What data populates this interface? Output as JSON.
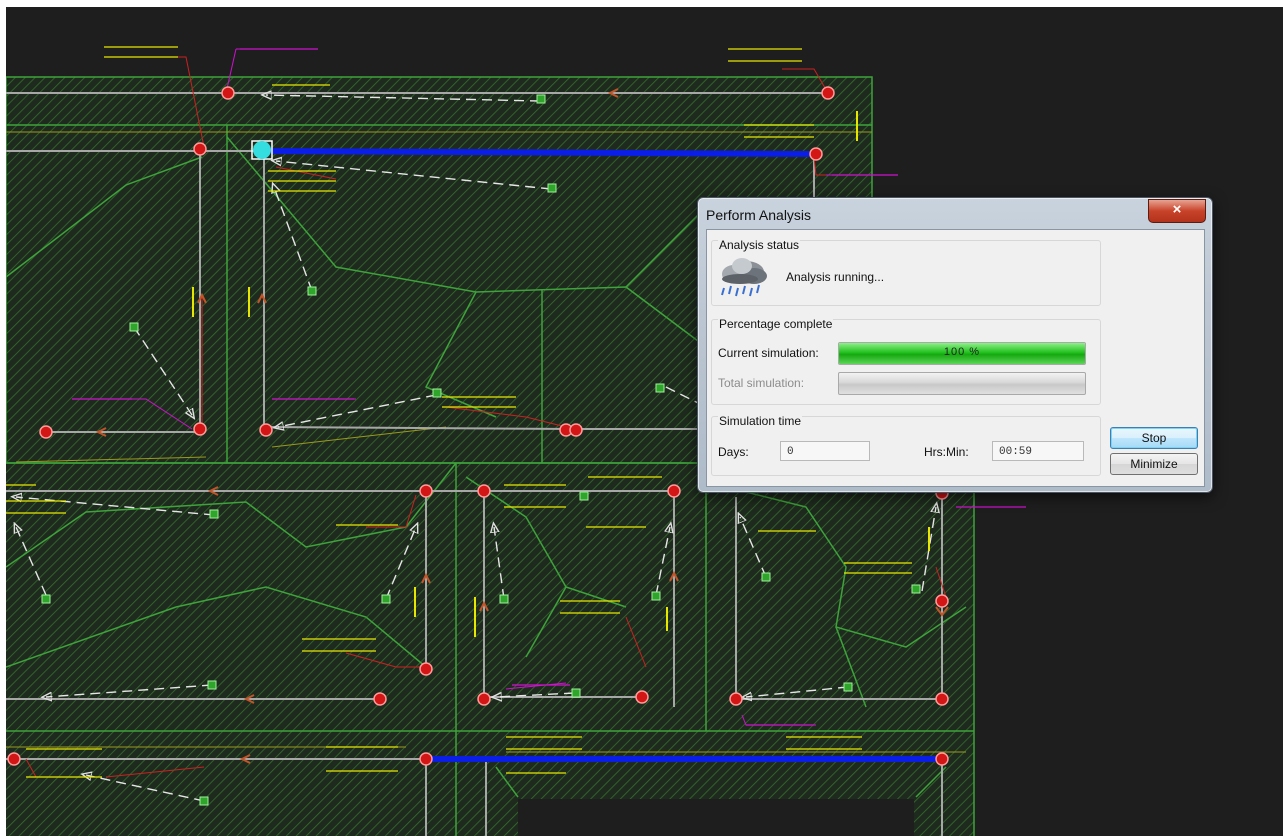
{
  "dialog": {
    "title": "Perform Analysis",
    "close_label": "×",
    "analysis_status": {
      "group_title": "Analysis status",
      "icon": "rain-cloud-icon",
      "message": "Analysis running..."
    },
    "percentage": {
      "group_title": "Percentage complete",
      "current_label": "Current simulation:",
      "current_value": 1.0,
      "current_text": "100 %",
      "total_label": "Total simulation:",
      "total_value": 0.0
    },
    "sim_time": {
      "group_title": "Simulation time",
      "days_label": "Days:",
      "days_value": "0",
      "hrsmin_label": "Hrs:Min:",
      "hrsmin_value": "00:59"
    },
    "stop_label": "Stop",
    "minimize_label": "Minimize"
  },
  "colors": {
    "canvas_bg": "#1e1e1e",
    "hatch": "#2f6b2a",
    "boundary": "#3da33a",
    "pipe_highlight": "#0a1ee6",
    "node": "#e81818",
    "label_yellow": "#e6e600",
    "label_magenta": "#d010d0",
    "leader_red": "#cc2020",
    "arrow_white": "#e8e8e8",
    "selected_node": "#33dde0"
  }
}
